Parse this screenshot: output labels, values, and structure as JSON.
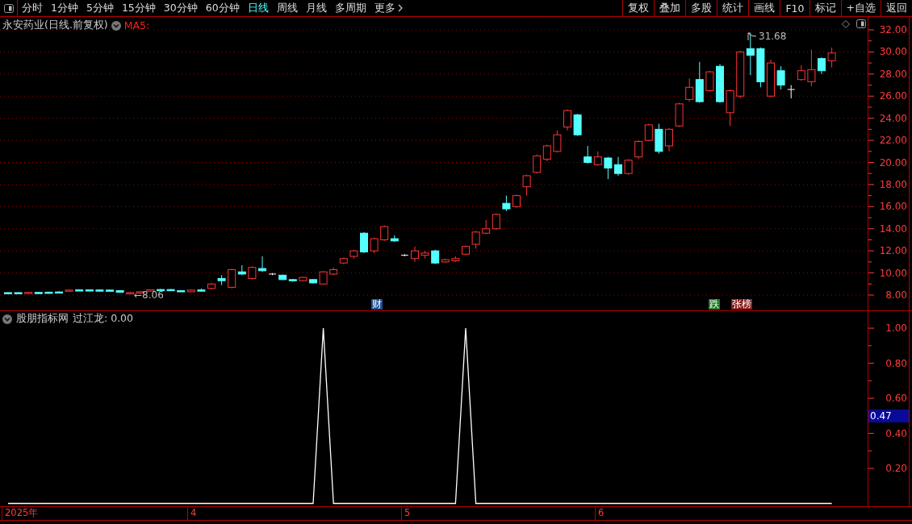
{
  "toolbar": {
    "periods": [
      {
        "label": "分时",
        "selected": false
      },
      {
        "label": "1分钟",
        "selected": false
      },
      {
        "label": "5分钟",
        "selected": false
      },
      {
        "label": "15分钟",
        "selected": false
      },
      {
        "label": "30分钟",
        "selected": false
      },
      {
        "label": "60分钟",
        "selected": false
      },
      {
        "label": "日线",
        "selected": true
      },
      {
        "label": "周线",
        "selected": false
      },
      {
        "label": "月线",
        "selected": false
      },
      {
        "label": "多周期",
        "selected": false
      },
      {
        "label": "更多",
        "selected": false
      }
    ],
    "buttons": [
      "复权",
      "叠加",
      "多股",
      "统计",
      "画线",
      "F10",
      "标记",
      "+自选",
      "返回"
    ]
  },
  "price_chart": {
    "title": "永安药业(日线.前复权)",
    "indicator": "MA5:",
    "low_marker": "←8.06",
    "high_marker": "31.68",
    "events": [
      {
        "label": "财",
        "color": "#1c4f96"
      },
      {
        "label": "跌",
        "color": "#1d7a24"
      },
      {
        "label": "张榜",
        "color": "#8a2020"
      }
    ],
    "chart_data": {
      "type": "candlestick",
      "ylim": [
        8,
        32
      ],
      "grid": true,
      "yticks": [
        {
          "value": 32,
          "label": "32.00"
        },
        {
          "value": 30,
          "label": "30.00"
        },
        {
          "value": 28,
          "label": "28.00"
        },
        {
          "value": 26,
          "label": "26.00"
        },
        {
          "value": 24,
          "label": "24.00"
        },
        {
          "value": 22,
          "label": "22.00"
        },
        {
          "value": 20,
          "label": "20.00"
        },
        {
          "value": 18,
          "label": "18.00"
        },
        {
          "value": 16,
          "label": "16.00"
        },
        {
          "value": 14,
          "label": "14.00"
        },
        {
          "value": 12,
          "label": "12.00"
        },
        {
          "value": 10,
          "label": "10.00"
        },
        {
          "value": 8,
          "label": "8.00"
        }
      ],
      "ohlc": [
        [
          8.22,
          8.26,
          8.18,
          8.2
        ],
        [
          8.22,
          8.25,
          8.18,
          8.2
        ],
        [
          8.18,
          8.27,
          8.16,
          8.24
        ],
        [
          8.24,
          8.28,
          8.2,
          8.22
        ],
        [
          8.26,
          8.3,
          8.22,
          8.24
        ],
        [
          8.28,
          8.35,
          8.24,
          8.26
        ],
        [
          8.4,
          8.5,
          8.38,
          8.45
        ],
        [
          8.47,
          8.52,
          8.42,
          8.45
        ],
        [
          8.47,
          8.5,
          8.43,
          8.45
        ],
        [
          8.46,
          8.5,
          8.42,
          8.44
        ],
        [
          8.45,
          8.5,
          8.41,
          8.43
        ],
        [
          8.4,
          8.45,
          8.2,
          8.25
        ],
        [
          8.2,
          8.3,
          8.15,
          8.22
        ],
        [
          8.2,
          8.35,
          8.06,
          8.3
        ],
        [
          8.35,
          8.5,
          8.3,
          8.48
        ],
        [
          8.5,
          8.55,
          8.45,
          8.48
        ],
        [
          8.5,
          8.55,
          8.42,
          8.45
        ],
        [
          8.4,
          8.45,
          8.3,
          8.35
        ],
        [
          8.3,
          8.5,
          8.28,
          8.45
        ],
        [
          8.46,
          8.6,
          8.4,
          8.45
        ],
        [
          8.6,
          9.1,
          8.5,
          9.0
        ],
        [
          9.5,
          9.8,
          8.9,
          9.3
        ],
        [
          8.7,
          10.4,
          8.6,
          10.3
        ],
        [
          10.1,
          10.7,
          9.8,
          9.9
        ],
        [
          9.5,
          10.6,
          9.4,
          10.5
        ],
        [
          10.4,
          11.5,
          10.1,
          10.2
        ],
        [
          9.9,
          10.0,
          9.8,
          9.9
        ],
        [
          9.8,
          9.85,
          9.35,
          9.4
        ],
        [
          9.4,
          9.45,
          9.2,
          9.3
        ],
        [
          9.3,
          9.65,
          9.25,
          9.6
        ],
        [
          9.4,
          9.45,
          9.05,
          9.1
        ],
        [
          9.0,
          10.15,
          8.95,
          10.1
        ],
        [
          9.9,
          10.5,
          9.8,
          10.3
        ],
        [
          10.9,
          11.4,
          10.8,
          11.3
        ],
        [
          11.5,
          12.1,
          11.3,
          12.0
        ],
        [
          13.6,
          13.7,
          11.8,
          11.9
        ],
        [
          12.0,
          13.2,
          11.8,
          13.1
        ],
        [
          13.0,
          14.3,
          12.9,
          14.2
        ],
        [
          13.1,
          13.4,
          12.8,
          12.9
        ],
        [
          11.6,
          11.7,
          11.5,
          11.6
        ],
        [
          11.3,
          12.4,
          11.0,
          12.0
        ],
        [
          11.6,
          12.0,
          11.3,
          11.8
        ],
        [
          12.0,
          12.1,
          10.8,
          10.9
        ],
        [
          11.0,
          11.3,
          10.9,
          11.2
        ],
        [
          11.1,
          11.5,
          11.0,
          11.3
        ],
        [
          11.7,
          12.5,
          11.6,
          12.4
        ],
        [
          12.6,
          13.8,
          12.2,
          13.7
        ],
        [
          13.6,
          14.8,
          13.5,
          14.0
        ],
        [
          14.0,
          15.4,
          13.9,
          15.3
        ],
        [
          16.3,
          17.0,
          15.6,
          15.8
        ],
        [
          16.0,
          17.1,
          15.9,
          17.0
        ],
        [
          17.8,
          18.9,
          17.0,
          18.8
        ],
        [
          19.1,
          20.7,
          19.0,
          20.6
        ],
        [
          20.3,
          21.6,
          20.1,
          21.5
        ],
        [
          21.0,
          22.9,
          20.9,
          22.5
        ],
        [
          23.2,
          24.8,
          22.9,
          24.7
        ],
        [
          24.3,
          24.4,
          22.4,
          22.5
        ],
        [
          20.5,
          21.5,
          19.9,
          20.0
        ],
        [
          19.8,
          21.0,
          19.7,
          20.5
        ],
        [
          20.4,
          20.5,
          18.5,
          19.5
        ],
        [
          19.8,
          20.5,
          18.8,
          19.0
        ],
        [
          19.0,
          20.3,
          18.9,
          20.2
        ],
        [
          20.5,
          22.0,
          20.3,
          21.9
        ],
        [
          22.0,
          23.5,
          21.9,
          23.4
        ],
        [
          23.0,
          23.5,
          20.8,
          21.0
        ],
        [
          21.5,
          23.1,
          21.0,
          23.0
        ],
        [
          23.3,
          25.4,
          23.2,
          25.3
        ],
        [
          25.7,
          27.6,
          25.5,
          26.8
        ],
        [
          27.5,
          29.1,
          25.4,
          25.5
        ],
        [
          26.5,
          28.3,
          26.4,
          28.2
        ],
        [
          28.7,
          28.9,
          25.4,
          25.5
        ],
        [
          24.5,
          26.6,
          23.3,
          26.5
        ],
        [
          26.0,
          30.1,
          25.8,
          30.0
        ],
        [
          30.3,
          31.68,
          27.9,
          29.7
        ],
        [
          30.3,
          30.4,
          26.8,
          27.3
        ],
        [
          26.0,
          29.3,
          25.9,
          29.0
        ],
        [
          28.3,
          28.7,
          26.6,
          27.0
        ],
        [
          26.6,
          27.0,
          25.8,
          26.6
        ],
        [
          27.5,
          28.8,
          27.4,
          28.3
        ],
        [
          27.3,
          30.2,
          26.9,
          28.4
        ],
        [
          29.4,
          29.5,
          28.0,
          28.3
        ],
        [
          29.2,
          30.4,
          28.6,
          29.9
        ]
      ]
    }
  },
  "indicator_panel": {
    "source": "股朋指标网",
    "reading": "过江龙: 0.00",
    "current_value": "0.47",
    "chart_data": {
      "type": "line",
      "ylim": [
        -0.016,
        1.097
      ],
      "yticks": [
        {
          "value": 1,
          "label": "1.00"
        },
        {
          "value": 0.8,
          "label": "0.80"
        },
        {
          "value": 0.6,
          "label": "0.60"
        },
        {
          "value": 0.4,
          "label": "0.40"
        },
        {
          "value": 0.2,
          "label": "0.20"
        }
      ],
      "series": [
        {
          "color": "#ffffff",
          "values": [
            0,
            0,
            0,
            0,
            0,
            0,
            0,
            0,
            0,
            0,
            0,
            0,
            0,
            0,
            0,
            0,
            0,
            0,
            0,
            0,
            0,
            0,
            0,
            0,
            0,
            0,
            0,
            0,
            0,
            0,
            0,
            1,
            0,
            0,
            0,
            0,
            0,
            0,
            0,
            0,
            0,
            0,
            0,
            0,
            0,
            1,
            0,
            0,
            0,
            0,
            0,
            0,
            0,
            0,
            0,
            0,
            0,
            0,
            0,
            0,
            0,
            0,
            0,
            0,
            0,
            0,
            0,
            0,
            0,
            0,
            0,
            0,
            0,
            0,
            0,
            0,
            0,
            0,
            0,
            0,
            0,
            0
          ]
        }
      ]
    }
  },
  "time_axis": {
    "labels": [
      "2025年",
      "4",
      "5",
      "6"
    ]
  }
}
